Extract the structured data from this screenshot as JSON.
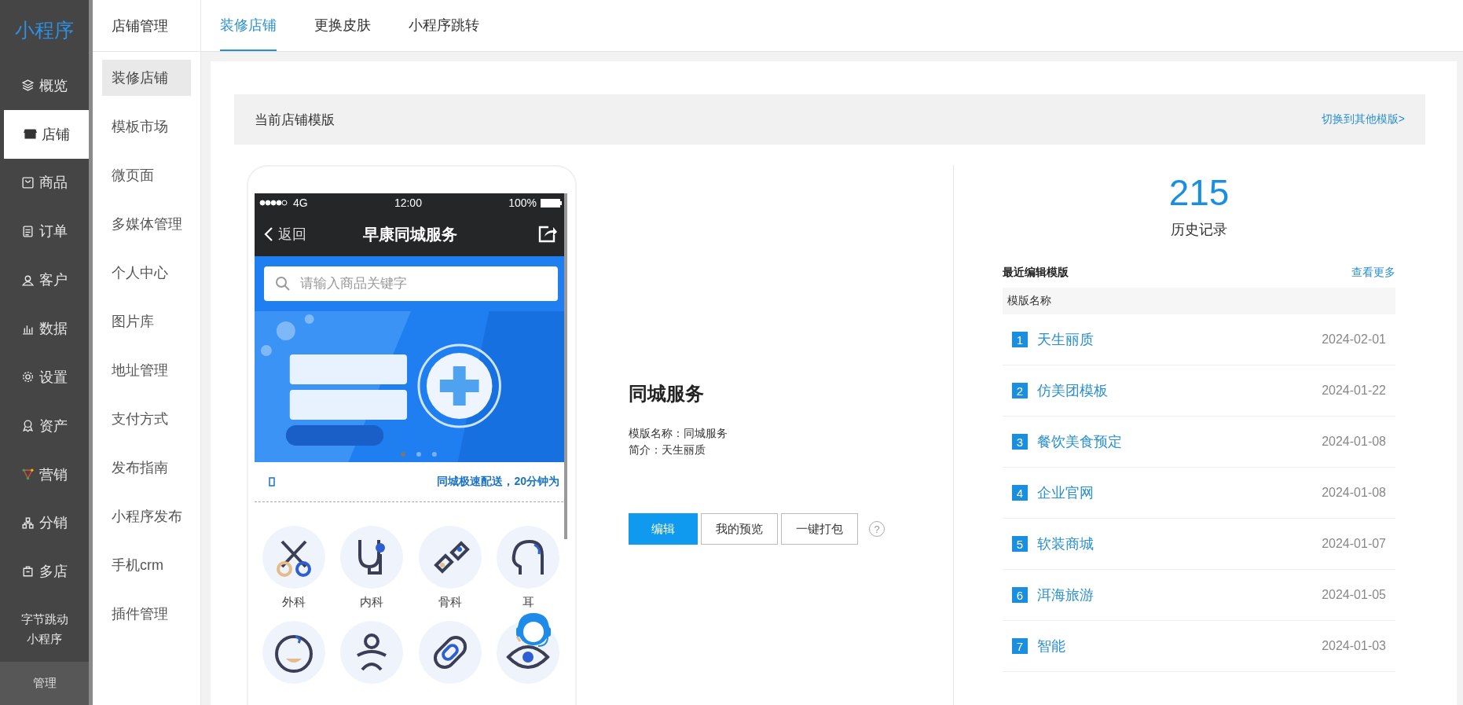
{
  "sidebar": {
    "logo": "小程序",
    "items": [
      {
        "label": "概览",
        "selected": false
      },
      {
        "label": "店铺",
        "selected": true
      },
      {
        "label": "商品",
        "selected": false
      },
      {
        "label": "订单",
        "selected": false
      },
      {
        "label": "客户",
        "selected": false
      },
      {
        "label": "数据",
        "selected": false
      },
      {
        "label": "设置",
        "selected": false
      },
      {
        "label": "资产",
        "selected": false
      },
      {
        "label": "营销",
        "selected": false
      },
      {
        "label": "分销",
        "selected": false
      },
      {
        "label": "多店",
        "selected": false
      },
      {
        "label": "字节跳动小程序",
        "selected": false
      }
    ],
    "footer": "管理"
  },
  "subnav": {
    "title": "店铺管理",
    "items": [
      {
        "label": "装修店铺",
        "selected": true
      },
      {
        "label": "模板市场",
        "selected": false
      },
      {
        "label": "微页面",
        "selected": false
      },
      {
        "label": "多媒体管理",
        "selected": false
      },
      {
        "label": "个人中心",
        "selected": false
      },
      {
        "label": "图片库",
        "selected": false
      },
      {
        "label": "地址管理",
        "selected": false
      },
      {
        "label": "支付方式",
        "selected": false
      },
      {
        "label": "发布指南",
        "selected": false
      },
      {
        "label": "小程序发布",
        "selected": false
      },
      {
        "label": "手机crm",
        "selected": false
      },
      {
        "label": "插件管理",
        "selected": false
      }
    ]
  },
  "tabs": [
    {
      "label": "装修店铺",
      "selected": true
    },
    {
      "label": "更换皮肤",
      "selected": false
    },
    {
      "label": "小程序跳转",
      "selected": false
    }
  ],
  "template_bar": {
    "title": "当前店铺模版",
    "link": "切换到其他模版>"
  },
  "phone": {
    "network": "4G",
    "time": "12:00",
    "battery": "100%",
    "back": "返回",
    "title": "早康同城服务",
    "search_placeholder": "请输入商品关键字",
    "notice": "同城极速配送，20分钟为",
    "categories": [
      {
        "label": "外科"
      },
      {
        "label": "内科"
      },
      {
        "label": "骨科"
      },
      {
        "label": "耳"
      }
    ]
  },
  "template": {
    "name": "同城服务",
    "info": [
      "模版名称：同城服务",
      "简介：天生丽质"
    ],
    "buttons": [
      {
        "label": "编辑",
        "primary": true
      },
      {
        "label": "我的预览",
        "primary": false
      },
      {
        "label": "一键打包",
        "primary": false
      }
    ],
    "help": "?"
  },
  "history": {
    "count": "215",
    "label": "历史记录",
    "recent_title": "最近编辑模版",
    "more": "查看更多",
    "column": "模版名称",
    "rows": [
      {
        "index": "1",
        "name": "天生丽质",
        "date": "2024-02-01"
      },
      {
        "index": "2",
        "name": "仿美团模板",
        "date": "2024-01-22"
      },
      {
        "index": "3",
        "name": "餐饮美食预定",
        "date": "2024-01-08"
      },
      {
        "index": "4",
        "name": "企业官网",
        "date": "2024-01-08"
      },
      {
        "index": "5",
        "name": "软装商城",
        "date": "2024-01-07"
      },
      {
        "index": "6",
        "name": "洱海旅游",
        "date": "2024-01-05"
      },
      {
        "index": "7",
        "name": "智能",
        "date": "2024-01-03"
      }
    ]
  }
}
